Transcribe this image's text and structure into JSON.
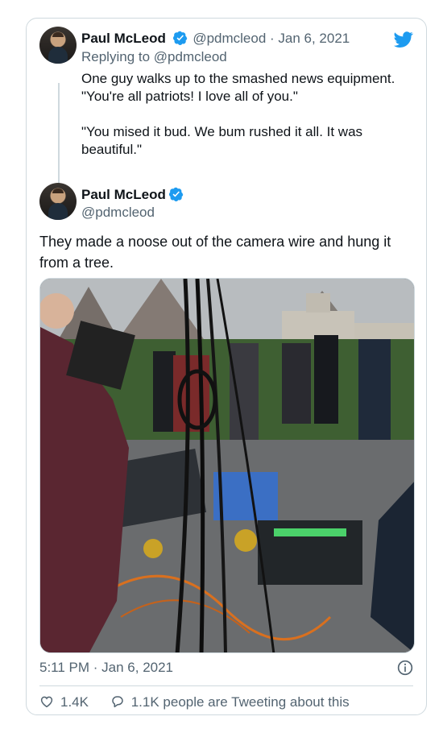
{
  "brand": {
    "twitter_color": "#1d9bf0",
    "verified_color": "#1d9bf0"
  },
  "parent_tweet": {
    "name": "Paul McLeod",
    "handle_date": "@pdmcleod · Jan 6, 2021",
    "replying_to": "Replying to @pdmcleod",
    "text": "One guy walks up to the smashed news equipment. \"You're all patriots! I love all of you.\"\n\n\"You mised it bud. We bum rushed it all. It was beautiful.\""
  },
  "main_tweet": {
    "name": "Paul McLeod",
    "handle": "@pdmcleod",
    "text": "They made a noose out of the camera wire and hung it from a tree.",
    "timestamp": "5:11 PM · Jan 6, 2021",
    "likes": "1.4K",
    "tweeting": "1.1K people are Tweeting about this"
  },
  "icons": [
    "twitter-bird-icon",
    "verified-badge-icon",
    "info-icon",
    "heart-icon",
    "speech-bubble-icon"
  ]
}
